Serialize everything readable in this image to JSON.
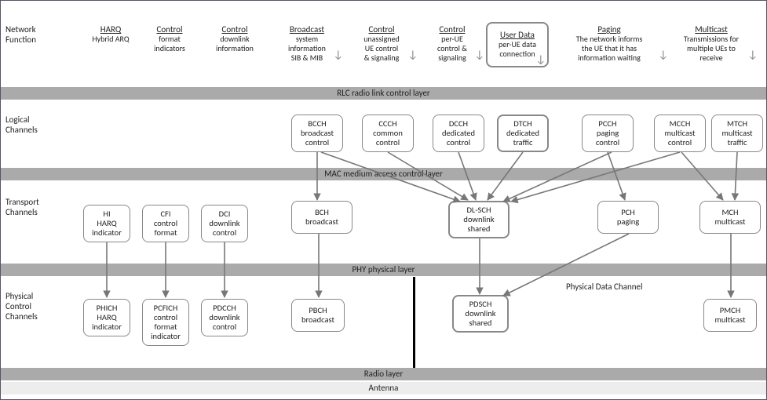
{
  "rowLabels": {
    "nf": "Network\nFunction",
    "lc": "Logical\nChannels",
    "tc": "Transport\nChannels",
    "pc": "Physical\nControl\nChannels"
  },
  "bars": {
    "rlc": "RLC radio link control layer",
    "mac": "MAC medium access control layer",
    "phy": "PHY physical layer",
    "radio": "Radio layer",
    "antenna": "Antenna"
  },
  "pdc": "Physical Data Channel",
  "nf": {
    "harq": {
      "t": "HARQ",
      "d": "Hybrid ARQ"
    },
    "ctrlFmt": {
      "t": "Control",
      "d": "format\nindicators"
    },
    "ctrlDl": {
      "t": "Control",
      "d": "downlink\ninformation"
    },
    "bcast": {
      "t": "Broadcast",
      "d": "system\ninformation\nSIB & MIB"
    },
    "ctrlUn": {
      "t": "Control",
      "d": "unassigned\nUE control\n& signaling"
    },
    "ctrlPerUe": {
      "t": "Control",
      "d": "per-UE\ncontrol &\nsignaling"
    },
    "userData": {
      "t": "User Data",
      "d": "per-UE data\nconnection"
    },
    "paging": {
      "t": "Paging",
      "d": "The network informs\nthe UE that it has\ninformation waiting"
    },
    "mcast": {
      "t": "Multicast",
      "d": "Transmissions for\nmultiple UEs to\nreceive"
    }
  },
  "logical": {
    "bcch": "BCCH\nbroadcast\ncontrol",
    "ccch": "CCCH\ncommon\ncontrol",
    "dcch": "DCCH\ndedicated\ncontrol",
    "dtch": "DTCH\ndedicated\ntraffic",
    "pcch": "PCCH\npaging\ncontrol",
    "mcch": "MCCH\nmulticast\ncontrol",
    "mtch": "MTCH\nmulticast\ntraffic"
  },
  "transport": {
    "hi": "HI\nHARQ\nindicator",
    "cfi": "CFI\ncontrol\nformat",
    "dci": "DCI\ndownlink\ncontrol",
    "bch": "BCH\nbroadcast",
    "dlsch": "DL-SCH\ndownlink\nshared",
    "pch": "PCH\npaging",
    "mch": "MCH\nmulticast"
  },
  "physical": {
    "phich": "PHICH\nHARQ\nindicator",
    "pcfich": "PCFICH\ncontrol\nformat\nindicator",
    "pdcch": "PDCCH\ndownlink\ncontrol",
    "pbch": "PBCH\nbroadcast",
    "pdsch": "PDSCH\ndownlink\nshared",
    "pmch": "PMCH\nmulticast"
  }
}
